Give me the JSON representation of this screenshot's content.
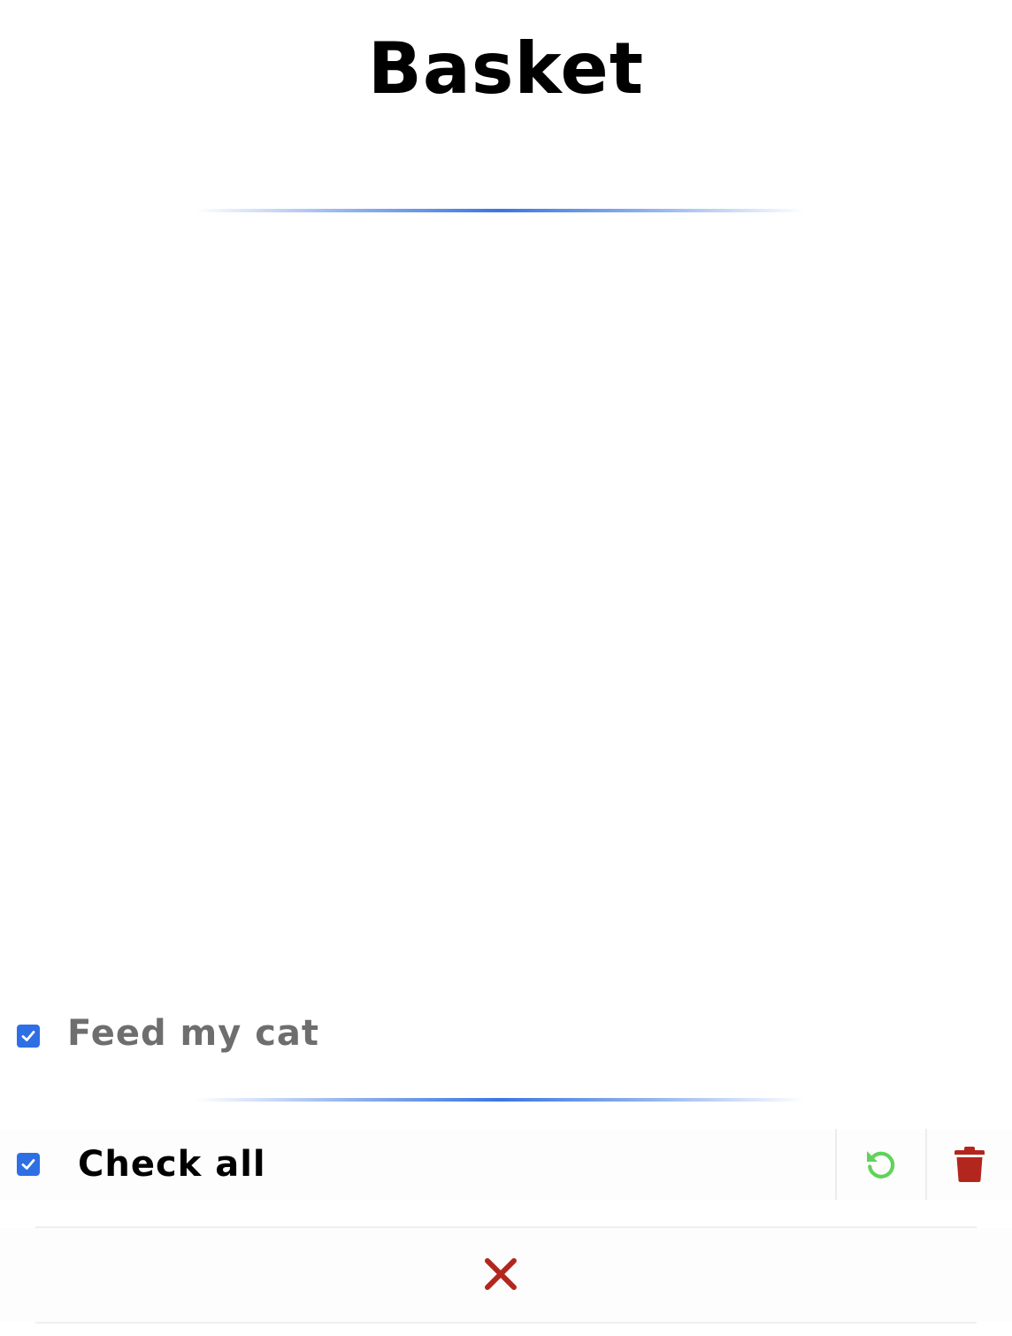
{
  "header": {
    "title": "Basket"
  },
  "tasks": [
    {
      "label": "Feed my cat",
      "checked": true
    }
  ],
  "footer": {
    "check_all_label": "Check all",
    "check_all_checked": true
  },
  "icons": {
    "restore": "restore-icon",
    "delete": "trash-icon",
    "close": "close-icon"
  },
  "colors": {
    "accent": "#3b76e2",
    "checkbox": "#2f6fe4",
    "restore": "#5fd35a",
    "delete": "#b3261e",
    "close": "#b3261e",
    "completed_text": "#6e6e6e"
  }
}
